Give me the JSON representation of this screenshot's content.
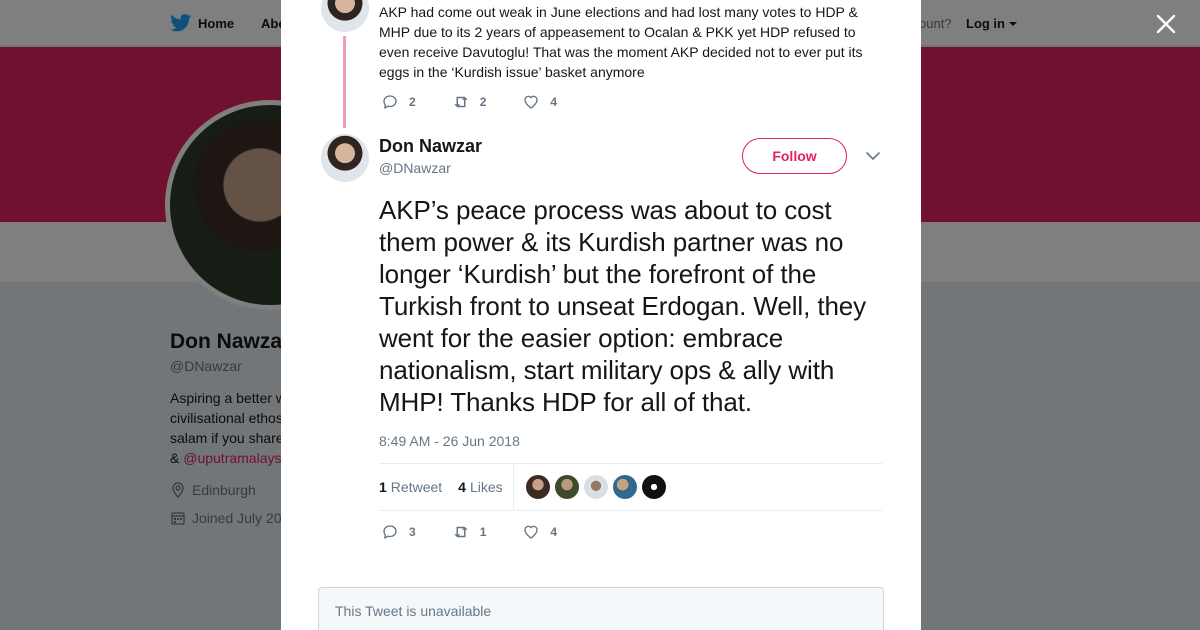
{
  "topbar": {
    "home_label": "Home",
    "about_label": "Abo",
    "login_question": "ccount?",
    "login_label": "Log in"
  },
  "profile": {
    "name": "Don Nawza",
    "handle": "@DNawzar",
    "bio_lines": [
      "Aspiring a better w",
      "civilisational ethos",
      "salam if you share"
    ],
    "bio_prefix": "& ",
    "bio_link": "@uputramalays",
    "location": "Edinburgh",
    "joined": "Joined July 20"
  },
  "previous_tweet": {
    "text": "AKP had come out weak in June elections and had lost many votes to HDP & MHP due to its 2 years of appeasement to Ocalan & PKK yet HDP refused to even receive Davutoglu! That was the moment AKP decided not to ever put its eggs in the ‘Kurdish issue’ basket anymore",
    "replies": "2",
    "retweets": "2",
    "likes": "4"
  },
  "tweet": {
    "author_name": "Don Nawzar",
    "author_handle": "@DNawzar",
    "follow_label": "Follow",
    "text": "AKP’s peace process was about to cost them power & its Kurdish partner was no longer ‘Kurdish’ but the forefront of the Turkish front to unseat Erdogan. Well, they went for the easier option: embrace nationalism, start military ops & ally with MHP! Thanks HDP for all of that.",
    "timestamp": "8:49 AM - 26 Jun 2018",
    "retweet_count": "1",
    "retweet_label": "Retweet",
    "like_count": "4",
    "like_label": "Likes",
    "replies": "3",
    "retweets": "1",
    "likes": "4"
  },
  "unavailable_text": "This Tweet is unavailable",
  "colors": {
    "accent": "#e0245e",
    "secondary_text": "#657786",
    "primary_text": "#14171a"
  },
  "icons": [
    "twitter-bird-icon",
    "caret-down-icon",
    "location-icon",
    "calendar-icon",
    "close-icon",
    "reply-icon",
    "retweet-icon",
    "heart-icon",
    "chevron-down-icon"
  ]
}
